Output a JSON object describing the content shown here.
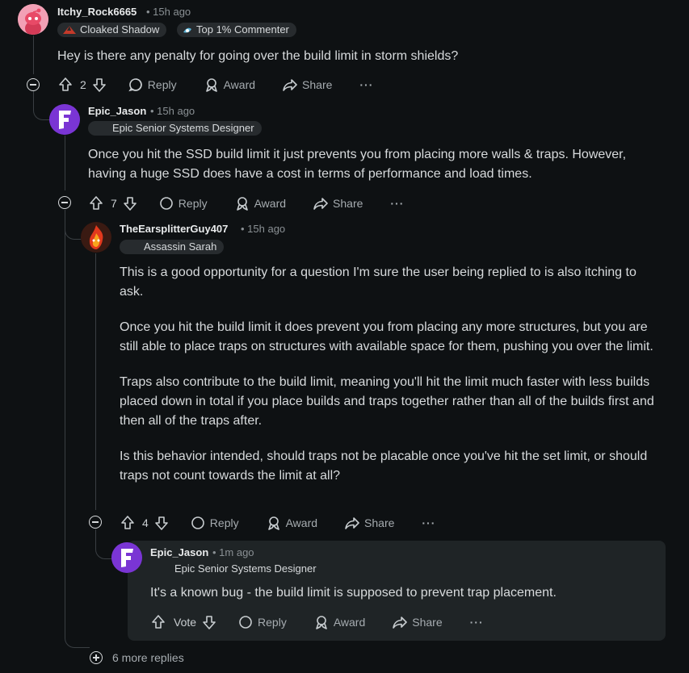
{
  "comments": [
    {
      "author": "Itchy_Rock6665",
      "time": "15h ago",
      "flairs": [
        "Cloaked Shadow",
        "Top 1% Commenter"
      ],
      "text": [
        "Hey is there any penalty for going over the build limit in storm shields?"
      ],
      "votes": "2"
    },
    {
      "author": "Epic_Jason",
      "time": "15h ago",
      "flair": "Epic Senior Systems Designer",
      "text": [
        "Once you hit the SSD build limit it just prevents you from placing more walls & traps. However, having a huge SSD does have a cost in terms of performance and load times."
      ],
      "votes": "7"
    },
    {
      "author": "TheEarsplitterGuy407",
      "time": "15h ago",
      "flair": "Assassin Sarah",
      "text": [
        "This is a good opportunity for a question I'm sure the user being replied to is also itching to ask.",
        "Once you hit the build limit it does prevent you from placing any more structures, but you are still able to place traps on structures with available space for them, pushing you over the limit.",
        "Traps also contribute to the build limit, meaning you'll hit the limit much faster with less builds placed down in total if you place builds and traps together rather than all of the builds first and then all of the traps after.",
        "Is this behavior intended, should traps not be placable once you've hit the set limit, or should traps not count towards the limit at all?"
      ],
      "votes": "4"
    },
    {
      "author": "Epic_Jason",
      "time": "1m ago",
      "flair": "Epic Senior Systems Designer",
      "text": [
        "It's a known bug - the build limit is supposed to prevent trap placement."
      ],
      "votes": "Vote"
    }
  ],
  "actions": {
    "reply": "Reply",
    "award": "Award",
    "share": "Share",
    "more": "···"
  },
  "more_replies": "6 more replies",
  "colors": {
    "background": "#0e1113",
    "highlight": "#1f2426",
    "fortnite_purple": "#6f2fc8"
  }
}
